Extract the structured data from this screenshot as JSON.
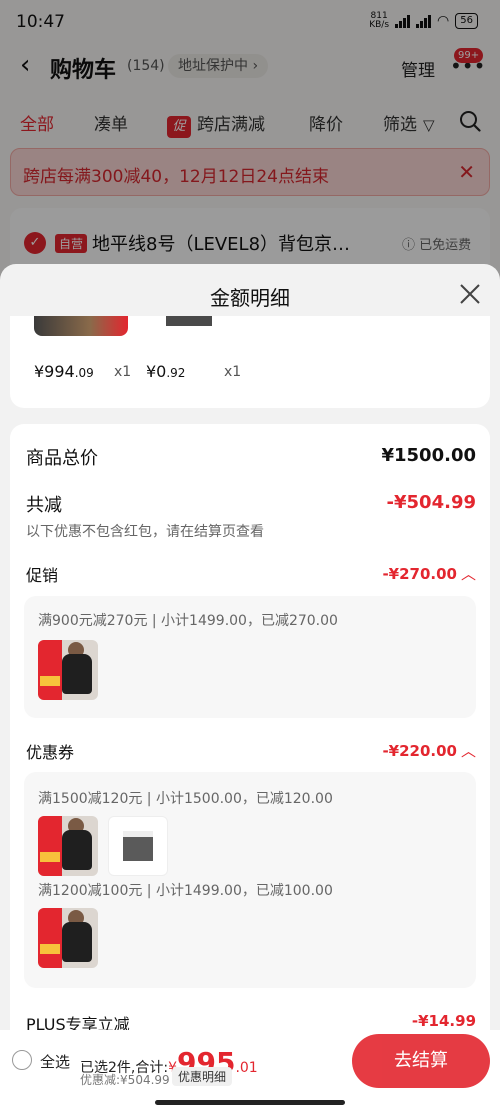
{
  "status_bar": {
    "time": "10:47",
    "speed": "811\nKB/s",
    "battery": "56"
  },
  "cart": {
    "back_icon": "chevron-left-icon",
    "title": "购物车",
    "count": "(154)",
    "address_protect": "地址保护中 ›",
    "manage": "管理",
    "more_badge": "99+"
  },
  "tabs": {
    "all": "全部",
    "combo": "凑单",
    "cross_store_icon": "促",
    "cross_store": "跨店满减",
    "price_drop": "降价",
    "filter": "筛选"
  },
  "promo_banner": {
    "text": "跨店每满300减40，12月12日24点结束"
  },
  "store": {
    "self_tag": "自营",
    "name": "地平线8号（LEVEL8）背包京…",
    "shipping": "ⓘ 已免运费"
  },
  "sheet": {
    "title": "金额明细",
    "items": [
      {
        "price_main": "¥994",
        "price_dec": ".09",
        "qty": "x1"
      },
      {
        "price_main": "¥0",
        "price_dec": ".92",
        "qty": "x1"
      }
    ],
    "total_label": "商品总价",
    "total_value": "¥1500.00",
    "discount_label": "共减",
    "discount_value": "-¥504.99",
    "discount_hint": "以下优惠不包含红包，请在结算页查看",
    "promotion": {
      "label": "促销",
      "value": "-¥270.00",
      "rule": "满900元减270元 | 小计1499.00，已减270.00"
    },
    "coupon": {
      "label": "优惠券",
      "value": "-¥220.00",
      "rule1": "满1500减120元 | 小计1500.00，已减120.00",
      "rule2": "满1200减100元 | 小计1499.00，已减100.00"
    },
    "plus": {
      "label": "PLUS专享立减",
      "value": "-¥14.99"
    }
  },
  "bottom_bar": {
    "select_all": "全选",
    "selected_prefix": "已选2件,合计:",
    "total_yen": "¥",
    "total_int": "995",
    "total_dec": ".01",
    "saved": "优惠减:¥504.99",
    "detail_button": "优惠明细",
    "checkout": "去结算"
  },
  "colors": {
    "accent": "#e3262f",
    "banner_bg": "#f8d6d3"
  }
}
